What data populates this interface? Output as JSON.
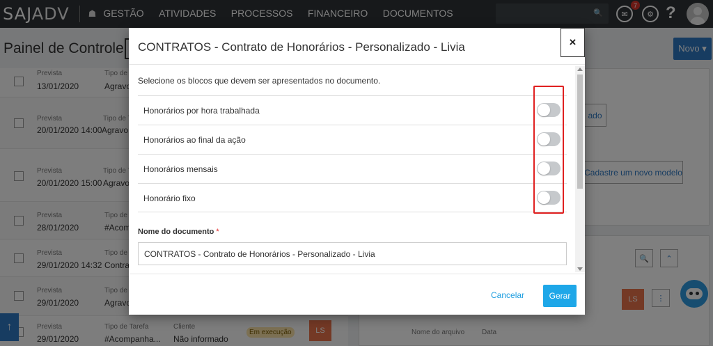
{
  "app": {
    "logo_bold": "SAJ",
    "logo_thin": "ADV",
    "nav": [
      "GESTÃO",
      "ATIVIDADES",
      "PROCESSOS",
      "FINANCEIRO",
      "DOCUMENTOS"
    ],
    "notification_count": "7"
  },
  "page": {
    "title": "Painel de Controle",
    "new_button": "Novo ▾"
  },
  "tasks": [
    {
      "label_date": "Prevista",
      "date": "13/01/2020",
      "label_type": "Tipo de",
      "type": "Agravo"
    },
    {
      "label_date": "Prevista",
      "date": "20/01/2020 14:00",
      "label_type": "Tipo de T",
      "type": "Agravo"
    },
    {
      "label_date": "Prevista",
      "date": "20/01/2020 15:00",
      "label_type": "Tipo de T",
      "type": "Agravo"
    },
    {
      "label_date": "Prevista",
      "date": "28/01/2020",
      "label_type": "Tipo de",
      "type": "#Acomp"
    },
    {
      "label_date": "Prevista",
      "date": "29/01/2020 14:32",
      "label_type": "Tipo de",
      "type": "Contra"
    },
    {
      "label_date": "Prevista",
      "date": "29/01/2020",
      "label_type": "Tipo de",
      "type": "Agravo"
    },
    {
      "label_date": "Prevista",
      "date": "29/01/2020",
      "label_type": "Tipo de Tarefa",
      "type": "#Acompanha...",
      "label_client": "Cliente",
      "client": "Não informado",
      "status": "Em execução",
      "initials": "LS"
    }
  ],
  "right_panel": {
    "btn_fragment": "ado",
    "new_model_button": "Cadastre um novo modelo",
    "initials": "LS",
    "col_file": "Nome do arquivo",
    "col_date": "Data"
  },
  "modal": {
    "title": "CONTRATOS - Contrato de Honorários - Personalizado - Livia",
    "close_label": "×",
    "intro": "Selecione os blocos que devem ser apresentados no documento.",
    "blocks": [
      {
        "label": "Honorários por hora trabalhada",
        "enabled": false
      },
      {
        "label": "Honorários ao final da ação",
        "enabled": false
      },
      {
        "label": "Honorários mensais",
        "enabled": false
      },
      {
        "label": "Honorário fixo",
        "enabled": false
      }
    ],
    "field_label": "Nome do documento",
    "required_mark": "*",
    "document_name": "CONTRATOS - Contrato de Honorários - Personalizado - Livia",
    "cancel_label": "Cancelar",
    "submit_label": "Gerar"
  },
  "colors": {
    "topbar": "#2f3337",
    "primary": "#2f79c3",
    "accent": "#1ea7e8",
    "highlight": "#e02020",
    "toggle_off": "#c6c9cc"
  }
}
